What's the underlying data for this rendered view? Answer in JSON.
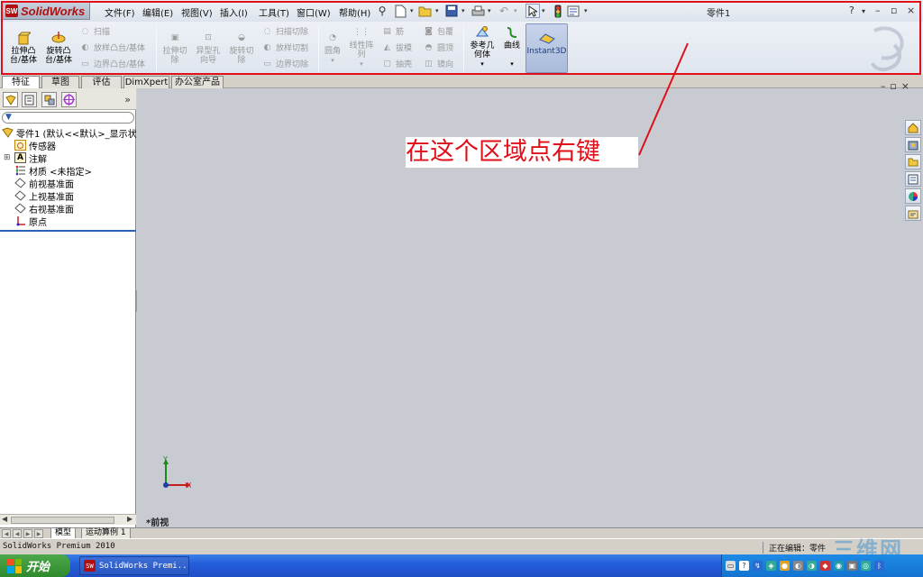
{
  "app": {
    "logo_mark": "SW",
    "logo_text": "SolidWorks",
    "document_title": "零件1"
  },
  "menu": [
    "文件(F)",
    "编辑(E)",
    "视图(V)",
    "插入(I)",
    "工具(T)",
    "窗口(W)",
    "帮助(H)"
  ],
  "title_controls": {
    "help": "?",
    "dropdown": "▾",
    "minimize": "–",
    "restore": "▫",
    "close": "×"
  },
  "ribbon": {
    "extrude_boss": "拉伸凸\n台/基体",
    "revolve_boss": "旋转凸\n台/基体",
    "sweep": "扫描",
    "loft_boss": "放样凸台/基体",
    "boundary_boss": "边界凸台/基体",
    "extrude_cut": "拉伸切\n除",
    "hole_wizard": "异型孔\n向导",
    "revolve_cut": "旋转切\n除",
    "swept_cut": "扫描切除",
    "lofted_cut": "放样切割",
    "boundary_cut": "边界切除",
    "fillet": "圆角",
    "linear_pattern": "线性阵\n列",
    "rib": "筋",
    "draft": "拔模",
    "shell": "抽壳",
    "wrap": "包覆",
    "dome": "圆顶",
    "mirror": "镜向",
    "reference_geometry": "参考几\n何体",
    "curves": "曲线",
    "instant3d": "Instant3D"
  },
  "command_tabs": [
    {
      "label": "特征",
      "active": true
    },
    {
      "label": "草图",
      "active": false
    },
    {
      "label": "评估",
      "active": false
    },
    {
      "label": "DimXpert",
      "active": false
    },
    {
      "label": "办公室产品",
      "active": false
    }
  ],
  "panel_more": "»",
  "feature_tree": [
    {
      "label": "零件1  (默认<<默认>_显示状态",
      "icon": "part-icon"
    },
    {
      "label": "传感器",
      "icon": "sensor-icon"
    },
    {
      "label": "注解",
      "icon": "annotation-icon",
      "expandable": true
    },
    {
      "label": "材质 <未指定>",
      "icon": "material-icon"
    },
    {
      "label": "前视基准面",
      "icon": "plane-icon"
    },
    {
      "label": "上视基准面",
      "icon": "plane-icon"
    },
    {
      "label": "右视基准面",
      "icon": "plane-icon"
    },
    {
      "label": "原点",
      "icon": "origin-icon"
    }
  ],
  "annotation_text": "在这个区域点右键",
  "view_label": "*前视",
  "triad": {
    "x": "X",
    "y": "Y"
  },
  "bottom_tabs": [
    {
      "label": "模型",
      "active": true
    },
    {
      "label": "运动算例 1",
      "active": false
    }
  ],
  "status": {
    "left": "SolidWorks Premium 2010",
    "right": "正在编辑：零件"
  },
  "watermark": "三维网",
  "taskbar": {
    "start_label": "开始",
    "task_item": "SolidWorks Premi..."
  },
  "colors": {
    "highlight_border": "#e0101a",
    "annotation_text": "#e0101a",
    "viewport_bg": "#c8cbd1",
    "taskbar": "#245edb",
    "start_button": "#3a9a38"
  }
}
